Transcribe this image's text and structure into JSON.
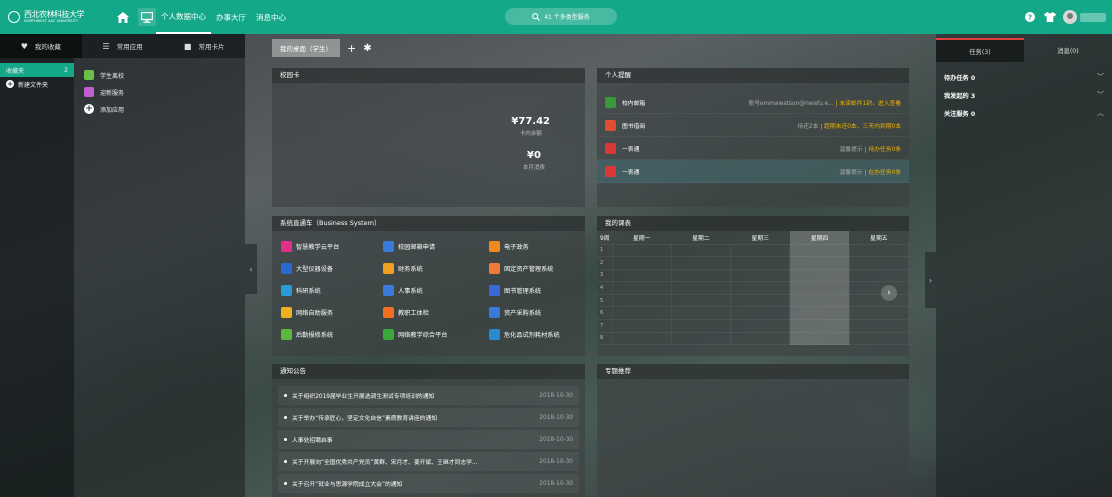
{
  "header": {
    "logo_cn": "西北农林科技大学",
    "logo_en": "NORTHWEST A&F UNIVERSITY",
    "nav": [
      "个人数据中心",
      "办事大厅",
      "消息中心"
    ],
    "search_placeholder": "41 个多类型服务"
  },
  "left_panel": {
    "tabs": [
      "我的收藏",
      "常用应用",
      "常用卡片"
    ],
    "folders": [
      {
        "label": "收藏夹",
        "count": "2"
      },
      {
        "label": "新建文件夹"
      }
    ],
    "apps": [
      {
        "label": "学生离校",
        "color": "#6cc04a"
      },
      {
        "label": "迎新服务",
        "color": "#c060d0"
      }
    ],
    "add_app_label": "添加应用"
  },
  "desk": {
    "tab_label": "我的桌面（学生）"
  },
  "campus_card": {
    "title": "校园卡",
    "balance": "¥77.42",
    "balance_label": "卡内余额",
    "monthly": "¥0",
    "monthly_label": "本月消费"
  },
  "reminders": {
    "title": "个人提醒",
    "items": [
      {
        "name": "校内邮箱",
        "text": "账号emmawatson@nwafu.e...",
        "sep": "|",
        "warn": "未读邮件1封，进入查看",
        "color": "#3a9a3a"
      },
      {
        "name": "图书借阅",
        "text": "待还2本",
        "sep": "|",
        "warn": "超期未还0本，三天内到期0本",
        "color": "#e05030"
      },
      {
        "name": "一表通",
        "text": "温馨提示",
        "sep": "|",
        "warn": "待办任务0条",
        "color": "#d83a3a"
      },
      {
        "name": "一表通",
        "text": "温馨提示",
        "sep": "|",
        "warn": "在办任务0条",
        "color": "#d83a3a"
      }
    ]
  },
  "systems": {
    "title": "系统直通车（Business System）",
    "items": [
      {
        "label": "智慧教学云平台",
        "color": "#e0308a"
      },
      {
        "label": "校园邮箱申请",
        "color": "#3a7ad8"
      },
      {
        "label": "电子政务",
        "color": "#f08a20"
      },
      {
        "label": "大型仪器设备",
        "color": "#2a6ad0"
      },
      {
        "label": "财务系统",
        "color": "#f0a020"
      },
      {
        "label": "固定资产管理系统",
        "color": "#f07a3a"
      },
      {
        "label": "科研系统",
        "color": "#2a9ad8"
      },
      {
        "label": "人事系统",
        "color": "#3a7ad8"
      },
      {
        "label": "图书管理系统",
        "color": "#3a6ad8"
      },
      {
        "label": "网络自助服务",
        "color": "#f0b020"
      },
      {
        "label": "教职工体检",
        "color": "#f07020"
      },
      {
        "label": "资产采购系统",
        "color": "#3a7ad8"
      },
      {
        "label": "后勤报修系统",
        "color": "#5ab83a"
      },
      {
        "label": "网络教学综合平台",
        "color": "#3aa83a"
      },
      {
        "label": "危化品试剂耗材系统",
        "color": "#2a8ad0"
      }
    ]
  },
  "schedule": {
    "title": "我的课表",
    "period_label": "9周",
    "days": [
      "星期一",
      "星期二",
      "星期三",
      "星期四",
      "星期五"
    ],
    "rows": [
      "1",
      "2",
      "3",
      "4",
      "5",
      "6",
      "7",
      "8"
    ]
  },
  "notices": {
    "title": "通知公告",
    "items": [
      {
        "title": "关于组织2019届毕业生开展选调生测试专项培训的通知",
        "date": "2018-10-30"
      },
      {
        "title": "关于举办“传承匠心，坚定文化自信”素质教育讲座的通知",
        "date": "2018-10-30"
      },
      {
        "title": "人事处招聘启事",
        "date": "2018-10-30"
      },
      {
        "title": "关于开展向“全国优秀共产党员”黄群、宋月才、姜开斌、王继才同志学...",
        "date": "2018-10-30"
      },
      {
        "title": "关于召开“就业与思源学院成立大会”的通知",
        "date": "2018-10-30"
      }
    ]
  },
  "topics": {
    "title": "专题推荐"
  },
  "right_panel": {
    "tabs": [
      "任务(3)",
      "消息(0)"
    ],
    "rows": [
      {
        "label": "待办任务 0",
        "chev": "v"
      },
      {
        "label": "我发起的 3",
        "chev": "v"
      },
      {
        "label": "关注服务 0",
        "chev": "^"
      }
    ]
  }
}
